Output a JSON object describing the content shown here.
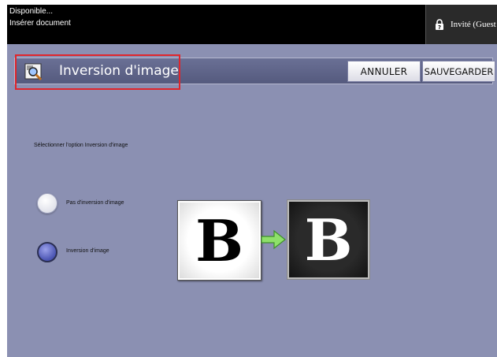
{
  "status": {
    "line1": "Disponible...",
    "line2": "Insérer document"
  },
  "user": {
    "label": "Invité (Guest",
    "icon": "lock-question-icon"
  },
  "header": {
    "title": "Inversion d'image",
    "icon": "magnifier-image-icon",
    "cancel_label": "ANNULER",
    "save_label": "SAUVEGARDER"
  },
  "main": {
    "instruction": "Sélectionner l'option Inversion d'image",
    "options": [
      {
        "label": "Pas d'inversion d'image",
        "selected": false
      },
      {
        "label": "Inversion d'image",
        "selected": true
      }
    ],
    "preview": {
      "normal_letter": "B",
      "inverted_letter": "B",
      "arrow_icon": "arrow-right-icon"
    }
  },
  "colors": {
    "background": "#8b90b2",
    "status_bar": "#000000",
    "header_bar": "#5f6589",
    "highlight": "#e0252b",
    "arrow": "#7ed957"
  }
}
